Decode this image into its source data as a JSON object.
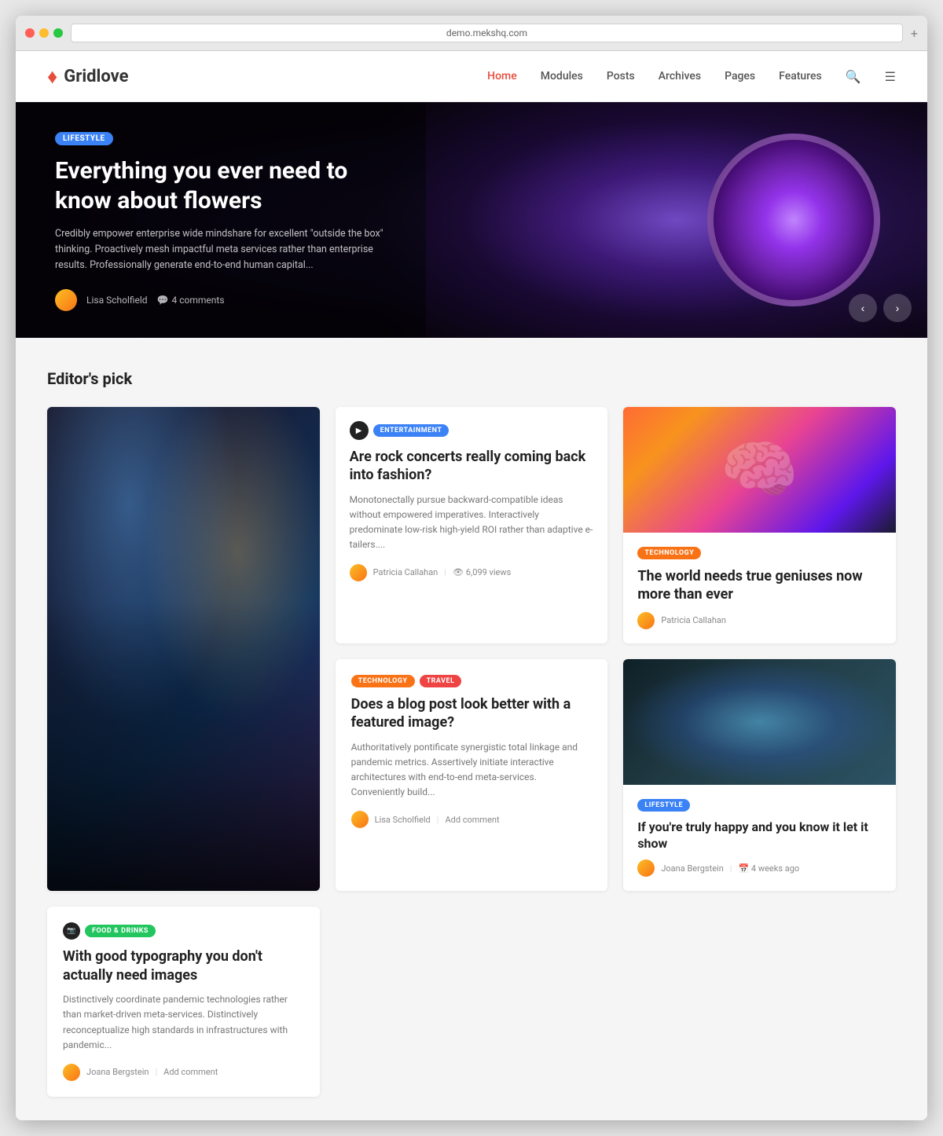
{
  "browser": {
    "url": "demo.mekshq.com",
    "expand_label": "+"
  },
  "header": {
    "logo_text": "Gridlove",
    "nav_items": [
      {
        "label": "Home",
        "active": true
      },
      {
        "label": "Modules",
        "active": false
      },
      {
        "label": "Posts",
        "active": false
      },
      {
        "label": "Archives",
        "active": false
      },
      {
        "label": "Pages",
        "active": false
      },
      {
        "label": "Features",
        "active": false
      }
    ]
  },
  "hero": {
    "badge": "LIFESTYLE",
    "title": "Everything you ever need to know about flowers",
    "excerpt": "Credibly empower enterprise wide mindshare for excellent \"outside the box\" thinking. Proactively mesh impactful meta services rather than enterprise results. Professionally generate end-to-end human capital...",
    "author": "Lisa Scholfield",
    "comments": "4 comments"
  },
  "editors_pick": {
    "section_title": "Editor's pick",
    "cards": [
      {
        "id": "large-concert",
        "type": "large-image",
        "image_alt": "Concert crowd"
      },
      {
        "id": "rock-concerts",
        "type": "text-with-badge",
        "badges": [
          {
            "label": "ENTERTAINMENT",
            "color": "blue"
          }
        ],
        "has_play": true,
        "title": "Are rock concerts really coming back into fashion?",
        "excerpt": "Monotonectally pursue backward-compatible ideas without empowered imperatives. Interactively predominate low-risk high-yield ROI rather than adaptive e-tailers....",
        "author": "Patricia Callahan",
        "views": "6,099 views"
      },
      {
        "id": "true-geniuses",
        "type": "dark-image",
        "badges": [
          {
            "label": "TECHNOLOGY",
            "color": "orange"
          }
        ],
        "title": "The world needs true geniuses now more than ever",
        "author": "Patricia Callahan"
      },
      {
        "id": "blog-post-image",
        "type": "no-image",
        "badges": [
          {
            "label": "TECHNOLOGY",
            "color": "orange"
          },
          {
            "label": "TRAVEL",
            "color": "red"
          }
        ],
        "title": "Does a blog post look better with a featured image?",
        "excerpt": "Authoritatively pontificate synergistic total linkage and pandemic metrics. Assertively initiate interactive architectures with end-to-end meta-services. Conveniently build...",
        "author": "Lisa Scholfield",
        "action": "Add comment"
      },
      {
        "id": "truly-happy",
        "type": "lifestyle-image",
        "badges": [
          {
            "label": "LIFESTYLE",
            "color": "blue"
          }
        ],
        "title": "If you're truly happy and you know it let it show",
        "author": "Joana Bergstein",
        "time": "4 weeks ago"
      },
      {
        "id": "typography",
        "type": "no-image-camera",
        "badges": [
          {
            "label": "FOOD & DRINKS",
            "color": "green"
          }
        ],
        "title": "With good typography you don't actually need images",
        "excerpt": "Distinctively coordinate pandemic technologies rather than market-driven meta-services. Distinctively reconceptualize high standards in infrastructures with pandemic...",
        "author": "Joana Bergstein",
        "action": "Add comment"
      }
    ]
  }
}
